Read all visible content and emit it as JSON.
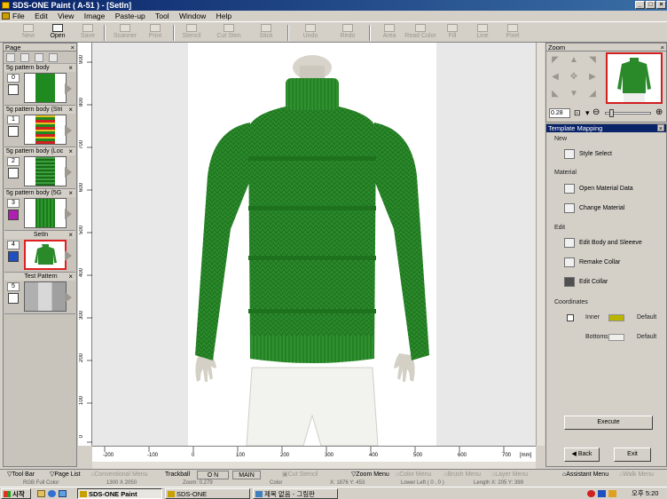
{
  "window": {
    "title": "SDS-ONE Paint ( A-51 ) - [SetIn]",
    "btn_min": "_",
    "btn_max": "□",
    "btn_close": "×"
  },
  "menu": [
    "File",
    "Edit",
    "View",
    "Image",
    "Paste-up",
    "Tool",
    "Window",
    "Help"
  ],
  "toolbar": [
    {
      "label": "New",
      "enabled": false
    },
    {
      "label": "Open",
      "enabled": true
    },
    {
      "label": "Save",
      "enabled": false
    },
    {
      "label": "Scanner",
      "enabled": false
    },
    {
      "label": "Print",
      "enabled": false
    },
    {
      "label": "Stencil",
      "enabled": false
    },
    {
      "label": "Cut Sten",
      "enabled": false
    },
    {
      "label": "Stick",
      "enabled": false
    },
    {
      "label": "Undo",
      "enabled": false
    },
    {
      "label": "Redo",
      "enabled": false
    },
    {
      "label": "Area",
      "enabled": false
    },
    {
      "label": "Read Color",
      "enabled": false
    },
    {
      "label": "Fill",
      "enabled": false
    },
    {
      "label": "Line",
      "enabled": false
    },
    {
      "label": "Pixel",
      "enabled": false
    }
  ],
  "page_panel": {
    "title": "Page",
    "close": "×",
    "pages": [
      {
        "name": "5g pattern body",
        "number": "0"
      },
      {
        "name": "5g pattern body (Stri",
        "number": "1"
      },
      {
        "name": "5g pattern body (Loc",
        "number": "2"
      },
      {
        "name": "5g pattern body (5G",
        "number": "3"
      },
      {
        "name": "SetIn",
        "number": "4"
      },
      {
        "name": "Test Pattern",
        "number": "5"
      }
    ]
  },
  "ruler_left": [
    "900",
    "800",
    "700",
    "600",
    "500",
    "400",
    "300",
    "200",
    "100",
    "0"
  ],
  "ruler_bottom": [
    "-200",
    "-100",
    "0",
    "100",
    "200",
    "300",
    "400",
    "500",
    "600",
    "700",
    "[mm]"
  ],
  "zoom_panel": {
    "title": "Zoom",
    "close": "×",
    "zoom_value": "0.28"
  },
  "template_mapping": {
    "title": "Template Mapping",
    "close": "×",
    "section_new": "New",
    "style_select": "Style Select",
    "section_material": "Material",
    "open_material": "Open Material Data",
    "change_material": "Change Material",
    "section_edit": "Edit",
    "edit_body": "Edit Body and Sleeeve",
    "remake_collar": "Remake Collar",
    "edit_collar": "Edit Collar",
    "section_coordinates": "Coordinates",
    "inner": "Inner",
    "bottoms": "Bottoms",
    "default_1": "Default",
    "default_2": "Default",
    "inner_color": "#b8b400",
    "bottoms_color": "#eeeeea",
    "execute": "Execute",
    "back": "Back",
    "exit": "Exit"
  },
  "bottom_bar": {
    "tool_bar": "Tool Bar",
    "page_list": "Page List",
    "conventional_menu": "Conventional Menu",
    "trackball": "Trackball",
    "on": "O N",
    "main": "MAIN",
    "cut_stencil": "Cut Stencil",
    "zoom_menu": "Zoom Menu",
    "color_menu": "Color Menu",
    "brush_menu": "Brush Menu",
    "layer_menu": "Layer Menu",
    "assistant_menu": "Assistant Menu",
    "walk_menu": "Walk Menu"
  },
  "status": {
    "mode": "RGB Full Color",
    "coords": "1300 X 2050",
    "zoom": "Zoom: 0.279",
    "color": "Color",
    "pos": "X: 1876  Y: 453",
    "layer": "Lower Left ( 0 , 0 )",
    "length": "Length X: 205  Y: 399"
  },
  "taskbar": {
    "start": "시작",
    "tasks": [
      "SDS-ONE Paint",
      "SDS-ONE",
      "제목 없음 - 그림판"
    ],
    "clock": "오후 5:20"
  },
  "colors": {
    "sweater": "#2a8a2a",
    "titlebar": "#0a246a"
  }
}
